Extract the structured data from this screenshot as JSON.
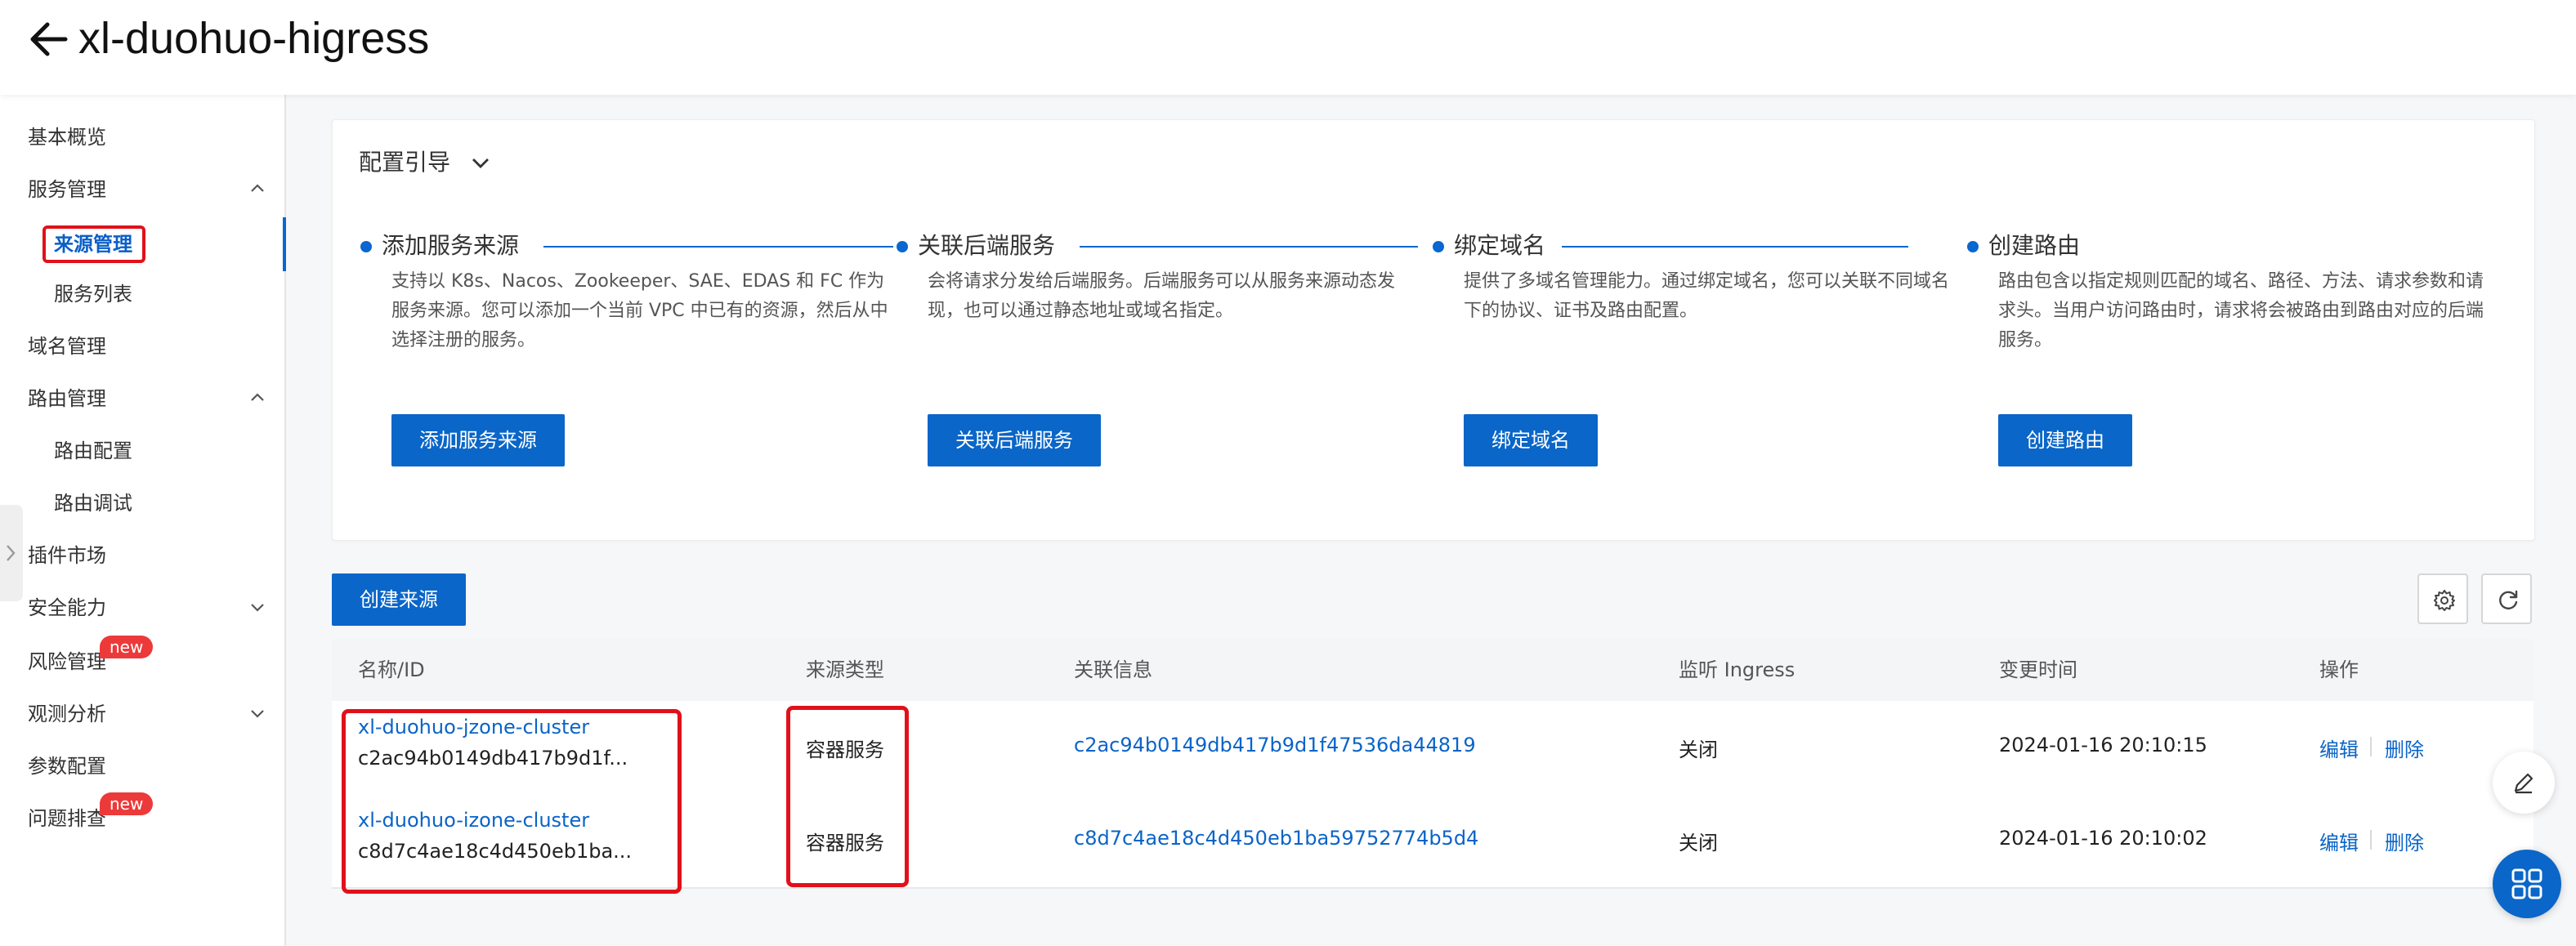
{
  "header": {
    "title": "xl-duohuo-higress"
  },
  "sidebar": {
    "items": [
      {
        "label": "基本概览"
      },
      {
        "label": "服务管理"
      },
      {
        "label": "来源管理"
      },
      {
        "label": "服务列表"
      },
      {
        "label": "域名管理"
      },
      {
        "label": "路由管理"
      },
      {
        "label": "路由配置"
      },
      {
        "label": "路由调试"
      },
      {
        "label": "插件市场"
      },
      {
        "label": "安全能力"
      },
      {
        "label": "风险管理",
        "badge": "new"
      },
      {
        "label": "观测分析"
      },
      {
        "label": "参数配置"
      },
      {
        "label": "问题排查",
        "badge": "new"
      }
    ]
  },
  "guide": {
    "title": "配置引导",
    "steps": [
      {
        "title": "添加服务来源",
        "desc": "支持以 K8s、Nacos、Zookeeper、SAE、EDAS 和 FC 作为服务来源。您可以添加一个当前 VPC 中已有的资源，然后从中选择注册的服务。",
        "button": "添加服务来源"
      },
      {
        "title": "关联后端服务",
        "desc": "会将请求分发给后端服务。后端服务可以从服务来源动态发现，也可以通过静态地址或域名指定。",
        "button": "关联后端服务"
      },
      {
        "title": "绑定域名",
        "desc": "提供了多域名管理能力。通过绑定域名，您可以关联不同域名下的协议、证书及路由配置。",
        "button": "绑定域名"
      },
      {
        "title": "创建路由",
        "desc": "路由包含以指定规则匹配的域名、路径、方法、请求参数和请求头。当用户访问路由时，请求将会被路由到路由对应的后端服务。",
        "button": "创建路由"
      }
    ]
  },
  "toolbar": {
    "create_label": "创建来源",
    "settings_icon": "gear-icon",
    "refresh_icon": "refresh-icon"
  },
  "table": {
    "columns": [
      "名称/ID",
      "来源类型",
      "关联信息",
      "监听 Ingress",
      "变更时间",
      "操作"
    ],
    "rows": [
      {
        "name": "xl-duohuo-jzone-cluster",
        "id": "c2ac94b0149db417b9d1f...",
        "type": "容器服务",
        "info": "c2ac94b0149db417b9d1f47536da44819",
        "ingress": "关闭",
        "time": "2024-01-16 20:10:15",
        "edit": "编辑",
        "delete": "删除"
      },
      {
        "name": "xl-duohuo-izone-cluster",
        "id": "c8d7c4ae18c4d450eb1ba...",
        "type": "容器服务",
        "info": "c8d7c4ae18c4d450eb1ba59752774b5d4",
        "ingress": "关闭",
        "time": "2024-01-16 20:10:02",
        "edit": "编辑",
        "delete": "删除"
      }
    ]
  },
  "colors": {
    "primary": "#0a66c8",
    "highlight": "#e1111b",
    "badge": "#ec3a3a"
  }
}
